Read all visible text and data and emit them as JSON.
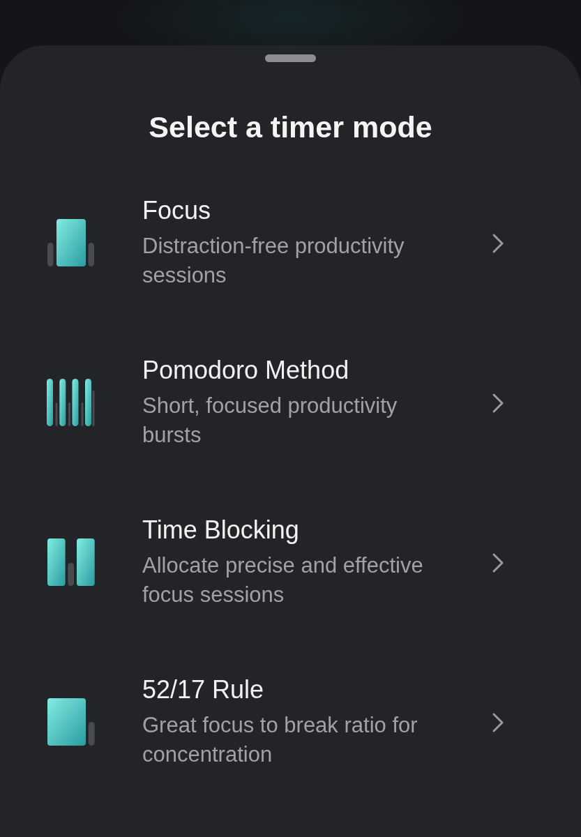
{
  "sheet": {
    "title": "Select a timer mode",
    "modes": [
      {
        "kind": "focus",
        "title": "Focus",
        "description": "Distraction-free productivity sessions"
      },
      {
        "kind": "pomodoro",
        "title": "Pomodoro Method",
        "description": "Short, focused productivity bursts"
      },
      {
        "kind": "blocking",
        "title": "Time Blocking",
        "description": "Allocate precise and effective focus sessions"
      },
      {
        "kind": "ratio",
        "title": "52/17 Rule",
        "description": "Great focus to break ratio for concentration"
      }
    ]
  }
}
